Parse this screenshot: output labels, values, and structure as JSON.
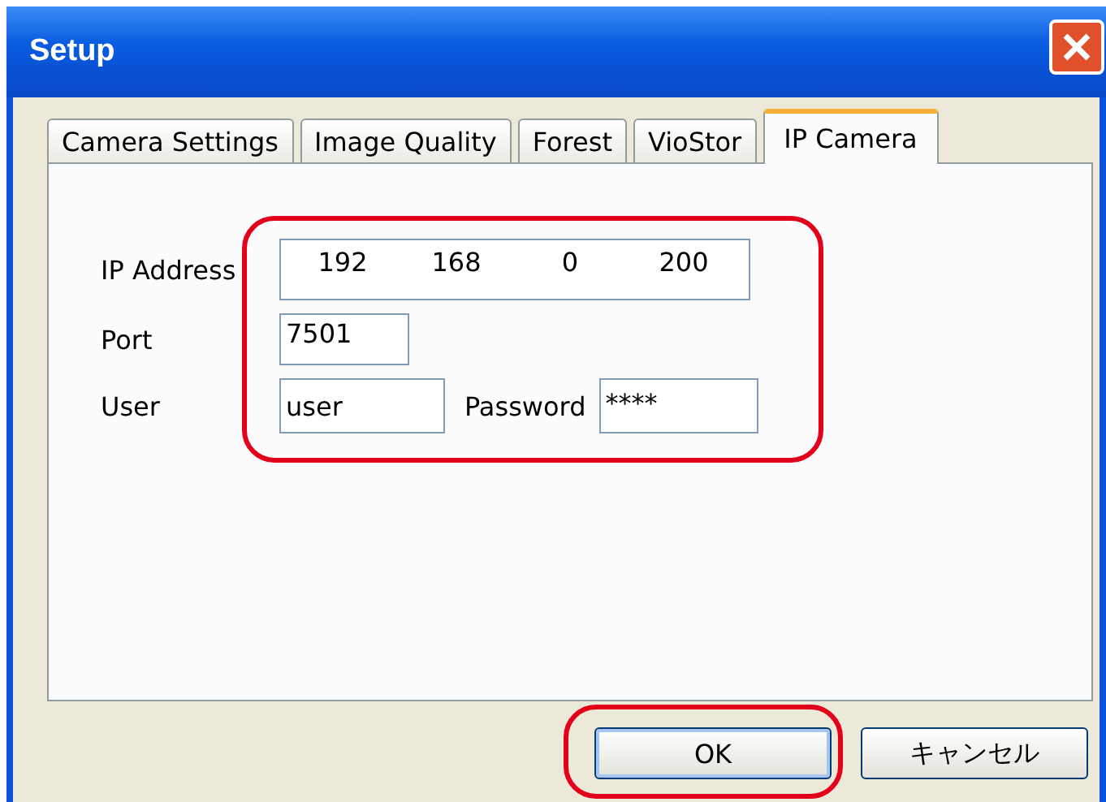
{
  "window": {
    "title": "Setup"
  },
  "tabs": [
    {
      "label": "Camera Settings",
      "selected": false
    },
    {
      "label": "Image Quality",
      "selected": false
    },
    {
      "label": "Forest",
      "selected": false
    },
    {
      "label": "VioStor",
      "selected": false
    },
    {
      "label": "IP Camera",
      "selected": true
    }
  ],
  "ip_address": {
    "label": "IP Address",
    "octets": [
      "192",
      "168",
      "0",
      "200"
    ]
  },
  "port": {
    "label": "Port",
    "value": "7501"
  },
  "user": {
    "label": "User",
    "value": "user"
  },
  "password": {
    "label": "Password",
    "value": "****"
  },
  "buttons": [
    {
      "label": "OK",
      "default": true
    },
    {
      "label": "キャンセル",
      "default": false
    }
  ]
}
